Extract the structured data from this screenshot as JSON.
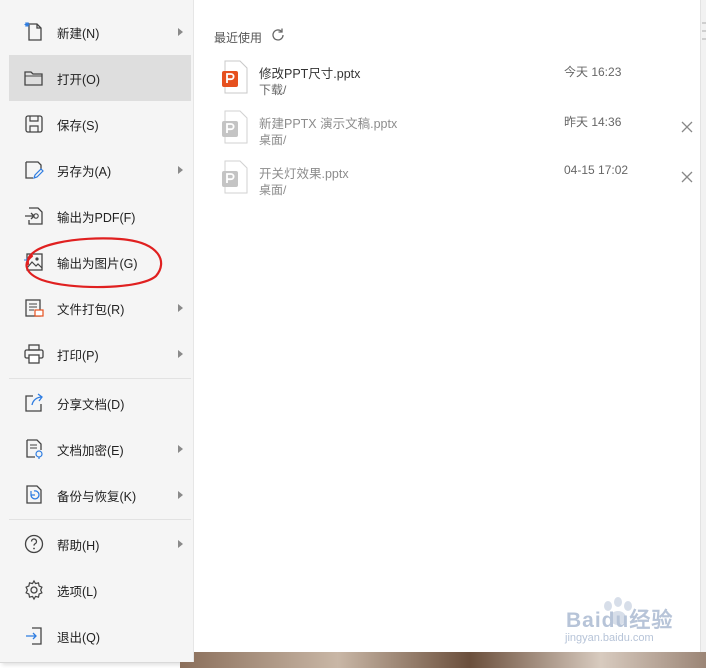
{
  "menu": {
    "items": [
      {
        "label": "新建(N)",
        "icon": "new-file-icon",
        "has_submenu": true
      },
      {
        "label": "打开(O)",
        "icon": "folder-open-icon",
        "has_submenu": false,
        "active": true
      },
      {
        "label": "保存(S)",
        "icon": "save-icon",
        "has_submenu": false
      },
      {
        "label": "另存为(A)",
        "icon": "save-as-icon",
        "has_submenu": true
      },
      {
        "label": "输出为PDF(F)",
        "icon": "export-pdf-icon",
        "has_submenu": false
      },
      {
        "label": "输出为图片(G)",
        "icon": "export-image-icon",
        "has_submenu": false
      },
      {
        "label": "文件打包(R)",
        "icon": "package-icon",
        "has_submenu": true
      },
      {
        "label": "打印(P)",
        "icon": "print-icon",
        "has_submenu": true
      },
      {
        "label": "分享文档(D)",
        "icon": "share-icon",
        "has_submenu": false
      },
      {
        "label": "文档加密(E)",
        "icon": "encrypt-icon",
        "has_submenu": true
      },
      {
        "label": "备份与恢复(K)",
        "icon": "backup-icon",
        "has_submenu": true
      },
      {
        "label": "帮助(H)",
        "icon": "help-icon",
        "has_submenu": true
      },
      {
        "label": "选项(L)",
        "icon": "settings-icon",
        "has_submenu": false
      },
      {
        "label": "退出(Q)",
        "icon": "exit-icon",
        "has_submenu": false
      }
    ]
  },
  "recent": {
    "title": "最近使用",
    "files": [
      {
        "name": "修改PPT尺寸.pptx",
        "path": "下载/",
        "time": "今天 16:23",
        "available": true
      },
      {
        "name": "新建PPTX 演示文稿.pptx",
        "path": "桌面/",
        "time": "昨天 14:36",
        "available": false
      },
      {
        "name": "开关灯效果.pptx",
        "path": "桌面/",
        "time": "04-15 17:02",
        "available": false
      }
    ]
  },
  "watermark": {
    "brand": "Baidu经验",
    "url": "jingyan.baidu.com"
  },
  "colors": {
    "accent": "#e6501e",
    "annotation": "#e02020",
    "active_bg": "#dedede"
  }
}
